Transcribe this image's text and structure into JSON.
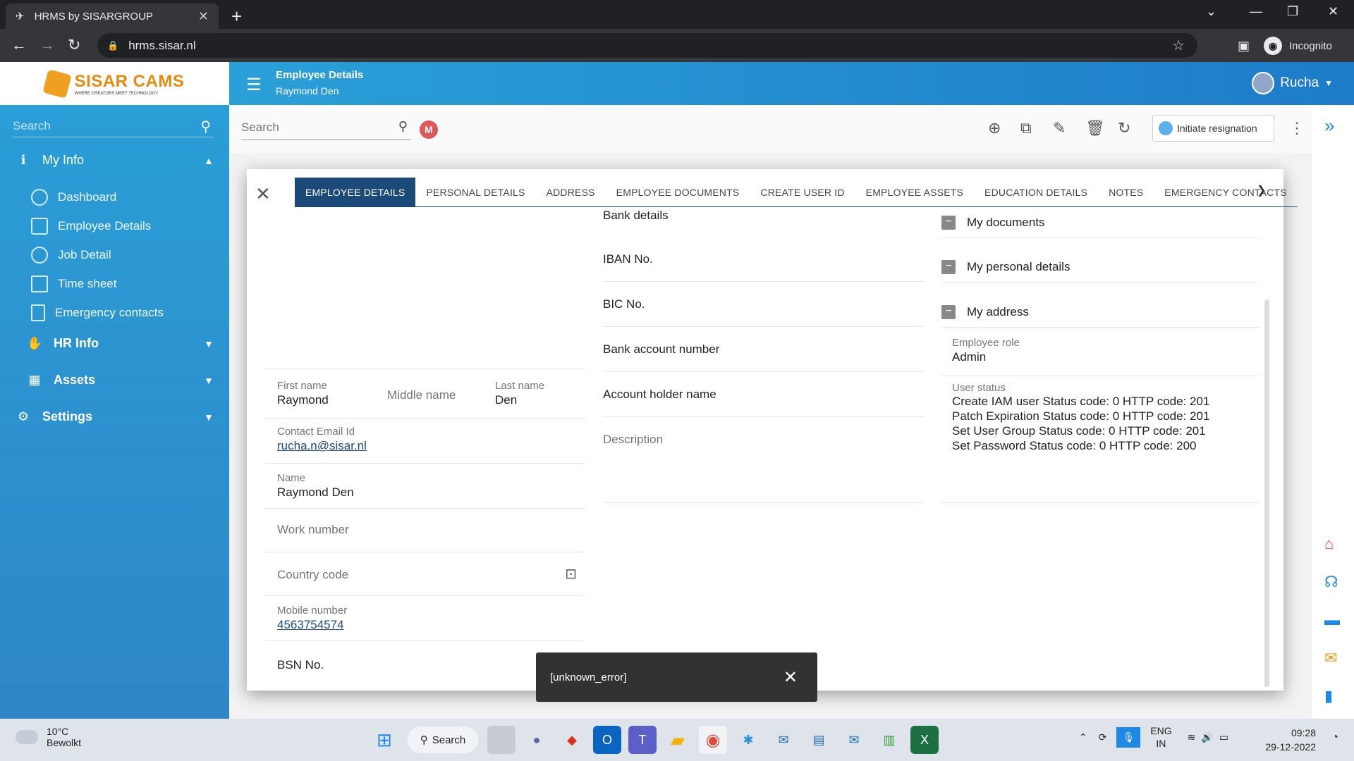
{
  "browser": {
    "tab_title": "HRMS by SISARGROUP",
    "url": "hrms.sisar.nl",
    "incognito_label": "Incognito"
  },
  "app": {
    "logo_text": "SISAR CAMS",
    "logo_tagline": "WHERE CREATORS MEET TECHNOLOGY",
    "header_title": "Employee Details",
    "header_subtitle": "Raymond Den",
    "user_name": "Rucha"
  },
  "sidebar": {
    "search_placeholder": "Search",
    "my_info": "My Info",
    "items": [
      {
        "label": "Dashboard"
      },
      {
        "label": "Employee Details"
      },
      {
        "label": "Job Detail"
      },
      {
        "label": "Time sheet"
      },
      {
        "label": "Emergency contacts"
      }
    ],
    "hr_info": "HR Info",
    "assets": "Assets",
    "settings": "Settings"
  },
  "toolbar": {
    "search_placeholder": "Search",
    "badge": "M",
    "initiate_resignation": "Initiate resignation"
  },
  "dialog": {
    "tabs": [
      "EMPLOYEE DETAILS",
      "PERSONAL DETAILS",
      "ADDRESS",
      "EMPLOYEE DOCUMENTS",
      "CREATE USER ID",
      "EMPLOYEE ASSETS",
      "EDUCATION DETAILS",
      "NOTES",
      "EMERGENCY CONTACTS"
    ],
    "left": {
      "first_name_label": "First name",
      "first_name": "Raymond",
      "middle_name_label": "Middle name",
      "last_name_label": "Last name",
      "last_name": "Den",
      "email_label": "Contact Email Id",
      "email": "rucha.n@sisar.nl",
      "name_label": "Name",
      "name": "Raymond  Den",
      "work_number_label": "Work number",
      "country_code_label": "Country code",
      "mobile_label": "Mobile number",
      "mobile": "4563754574",
      "bsn_label": "BSN No."
    },
    "middle": {
      "bank_details": "Bank details",
      "iban": "IBAN No.",
      "bic": "BIC No.",
      "bank_account": "Bank account number",
      "account_holder": "Account holder name",
      "description": "Description"
    },
    "right": {
      "my_documents": "My documents",
      "my_personal_details": "My personal details",
      "my_address": "My address",
      "role_label": "Employee role",
      "role": "Admin",
      "status_label": "User status",
      "status_lines": [
        "Create IAM user Status code: 0 HTTP code: 201",
        "Patch Expiration Status code: 0 HTTP code: 201",
        "Set User Group Status code: 0 HTTP code: 201",
        "Set Password Status code: 0 HTTP code: 200"
      ]
    }
  },
  "snackbar": {
    "message": "[unknown_error]"
  },
  "taskbar": {
    "temperature": "10°C",
    "weather": "Bewolkt",
    "search_label": "Search",
    "lang": "ENG",
    "region": "IN",
    "time": "09:28",
    "date": "29-12-2022"
  }
}
